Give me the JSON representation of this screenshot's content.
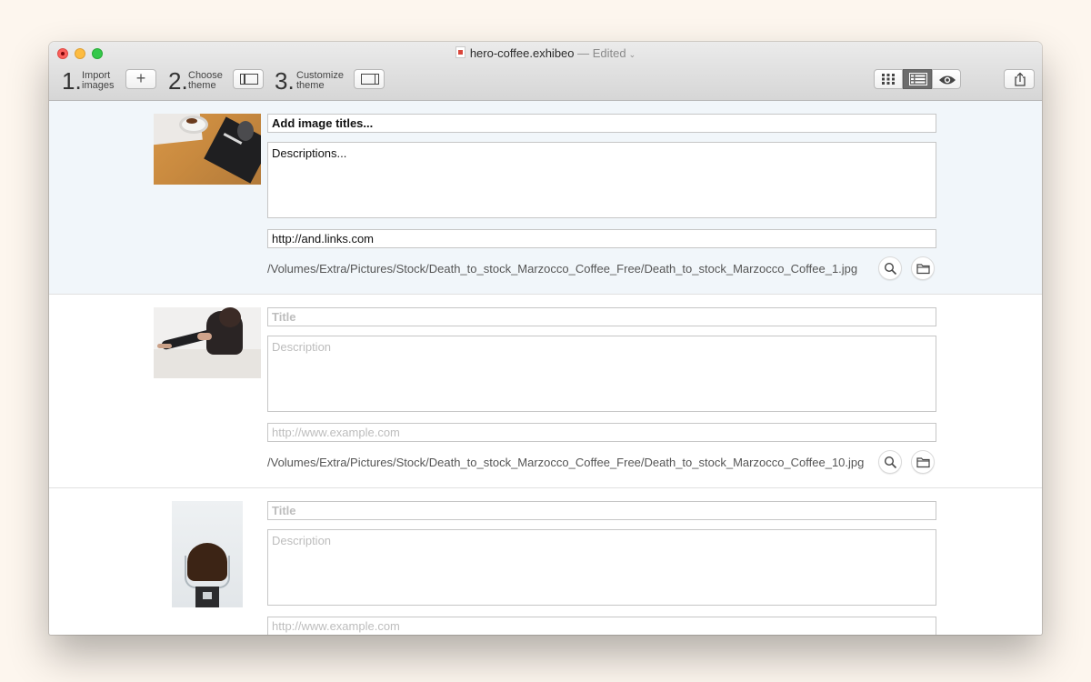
{
  "window": {
    "title": "hero-coffee.exhibeo",
    "status": "— Edited"
  },
  "toolbar": {
    "steps": [
      {
        "number": "1.",
        "line1": "Import",
        "line2": "images"
      },
      {
        "number": "2.",
        "line1": "Choose",
        "line2": "theme"
      },
      {
        "number": "3.",
        "line1": "Customize",
        "line2": "theme"
      }
    ],
    "import_button_label": "+",
    "view_modes": [
      "grid",
      "list",
      "preview"
    ],
    "selected_view": "list"
  },
  "rows": [
    {
      "title_value": "Add image titles...",
      "description_value": "Descriptions...",
      "url_value": "http://and.links.com",
      "path": "/Volumes/Extra/Pictures/Stock/Death_to_stock_Marzocco_Coffee_Free/Death_to_stock_Marzocco_Coffee_1.jpg",
      "selected": true
    },
    {
      "title_placeholder": "Title",
      "description_placeholder": "Description",
      "url_placeholder": "http://www.example.com",
      "path": "/Volumes/Extra/Pictures/Stock/Death_to_stock_Marzocco_Coffee_Free/Death_to_stock_Marzocco_Coffee_10.jpg",
      "selected": false
    },
    {
      "title_placeholder": "Title",
      "description_placeholder": "Description",
      "url_placeholder": "http://www.example.com",
      "selected": false
    }
  ],
  "icons": {
    "reveal": "search-icon",
    "folder": "folder-icon",
    "share": "share-icon"
  },
  "colors": {
    "background": "#fdf6ee",
    "selected_row": "#f1f6fa",
    "close": "#fc605c",
    "minimize": "#fdbc40",
    "maximize": "#34c84a",
    "placeholder_text": "#bdbdbd"
  }
}
